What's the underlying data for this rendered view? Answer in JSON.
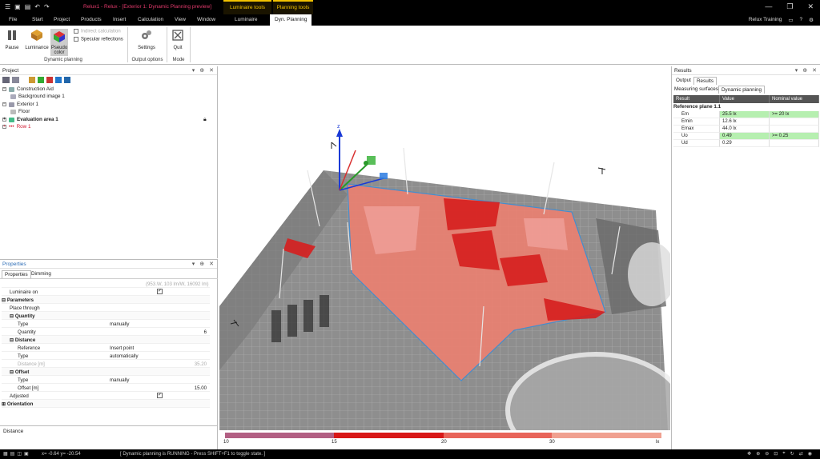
{
  "titlebar": {
    "title": "Relux1 - Relux - [Exterior 1: Dynamic Planning preview]",
    "context_tab_1": "Luminaire tools",
    "context_tab_2": "Planning tools"
  },
  "menu": {
    "items": [
      "File",
      "Start",
      "Project",
      "Products",
      "Insert",
      "Calculation",
      "View",
      "Window",
      "Luminaire",
      "Dyn. Planning"
    ],
    "active": "Dyn. Planning",
    "account": "Relux Training"
  },
  "ribbon": {
    "pause": "Pause",
    "luminance": "Luminance",
    "pseudo_color": "Pseudo color",
    "indirect_calc": "Indirect calculation",
    "specular": "Specular reflections",
    "settings": "Settings",
    "quit": "Quit",
    "group_dynamic": "Dynamic planning",
    "group_output": "Output options",
    "group_mode": "Mode"
  },
  "project": {
    "title": "Project",
    "tree": [
      {
        "label": "Construction Aid",
        "indent": 0,
        "bold": false,
        "color": "#222"
      },
      {
        "label": "Background image 1",
        "indent": 1,
        "bold": false,
        "color": "#222"
      },
      {
        "label": "Exterior 1",
        "indent": 0,
        "bold": false,
        "color": "#222"
      },
      {
        "label": "Floor",
        "indent": 1,
        "bold": false,
        "color": "#222"
      },
      {
        "label": "Evaluation area 1",
        "indent": 0,
        "bold": true,
        "color": "#222"
      },
      {
        "label": "Row 1",
        "indent": 0,
        "bold": false,
        "color": "#d0142c"
      }
    ]
  },
  "properties": {
    "title": "Properties",
    "tabs": [
      "Properties",
      "Dimming"
    ],
    "header_value": "(953.W, 103 lm/W, 16092 lm)",
    "rows": {
      "luminaire_on": "Luminaire on",
      "parameters": "Parameters",
      "place_through": "Place through",
      "quantity_sec": "Quantity",
      "type_label": "Type",
      "type_value": "manually",
      "quantity_label": "Quantity",
      "quantity_value": "6",
      "distance_sec": "Distance",
      "reference_label": "Reference",
      "reference_value": "Insert point",
      "type2_value": "automatically",
      "distance_m_label": "Distance [m]",
      "distance_m_value": "35.20",
      "offset_sec": "Offset",
      "type3_value": "manually",
      "offset_m_label": "Offset [m]",
      "offset_m_value": "15.00",
      "adjusted": "Adjusted",
      "orientation": "Orientation"
    },
    "description": "Distance"
  },
  "viewport": {
    "axis_z": "z"
  },
  "legend": {
    "ticks": [
      "10",
      "15",
      "20",
      "30",
      "lx"
    ],
    "colors": [
      "#b25f83",
      "#d81818",
      "#e8645a",
      "#f0a090"
    ]
  },
  "results": {
    "title": "Results",
    "tabs": [
      "Output",
      "Results"
    ],
    "subtabs": [
      "Measuring surfaces",
      "Dynamic planning"
    ],
    "columns": [
      "Result",
      "Value",
      "Nominal value"
    ],
    "group": "Reference plane 1.1",
    "rows": [
      {
        "name": "Em",
        "value": "25.5 lx",
        "nominal": ">= 20 lx",
        "ok": true
      },
      {
        "name": "Emin",
        "value": "12.6 lx",
        "nominal": "",
        "ok": false
      },
      {
        "name": "Emax",
        "value": "44.0 lx",
        "nominal": "",
        "ok": false
      },
      {
        "name": "Uo",
        "value": "0.49",
        "nominal": ">= 0.25",
        "ok": true
      },
      {
        "name": "Ud",
        "value": "0.29",
        "nominal": "",
        "ok": false
      }
    ]
  },
  "statusbar": {
    "coords": "x= -0.64 y= -20.54",
    "message": "[ Dynamic planning is RUNNING - Press SHIFT+F1 to toggle state. ]"
  }
}
